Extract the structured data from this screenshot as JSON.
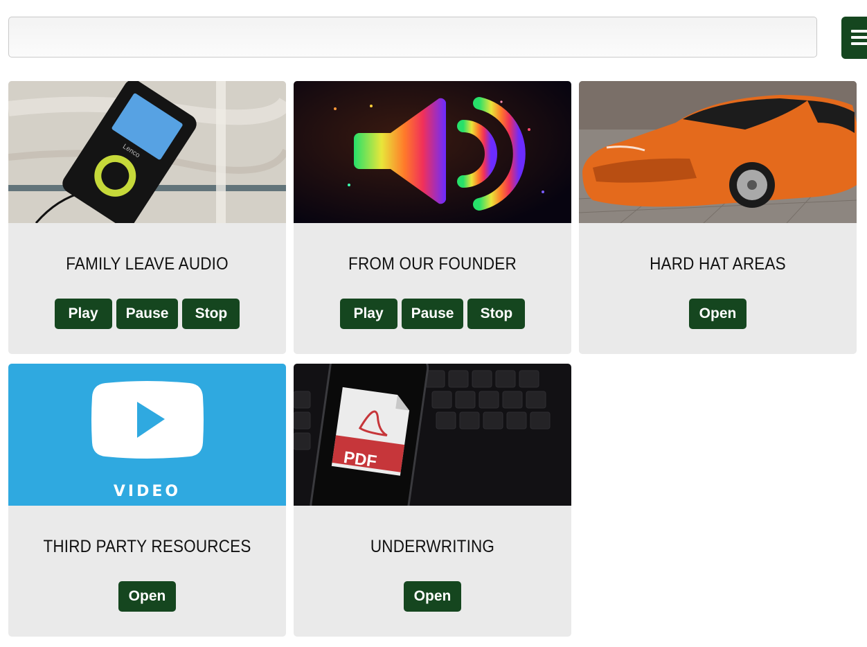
{
  "search": {
    "value": "",
    "placeholder": ""
  },
  "menu": {
    "icon": "hamburger-icon"
  },
  "colors": {
    "button": "#15461f",
    "card_bg": "#eaeaea",
    "video_blue": "#2fa9e0"
  },
  "cards": [
    {
      "title": "FAMILY LEAVE AUDIO",
      "image": "mp3-player-photo",
      "buttons": [
        "Play",
        "Pause",
        "Stop"
      ]
    },
    {
      "title": "FROM OUR FOUNDER",
      "image": "speaker-icon-rainbow",
      "buttons": [
        "Play",
        "Pause",
        "Stop"
      ]
    },
    {
      "title": "HARD HAT AREAS",
      "image": "orange-sports-car-photo",
      "buttons": [
        "Open"
      ]
    },
    {
      "title": "THIRD PARTY RESOURCES",
      "image": "video-play-icon",
      "image_text": "VIDEO",
      "buttons": [
        "Open"
      ]
    },
    {
      "title": "UNDERWRITING",
      "image": "pdf-phone-keyboard-photo",
      "image_text": "PDF",
      "buttons": [
        "Open"
      ]
    }
  ]
}
